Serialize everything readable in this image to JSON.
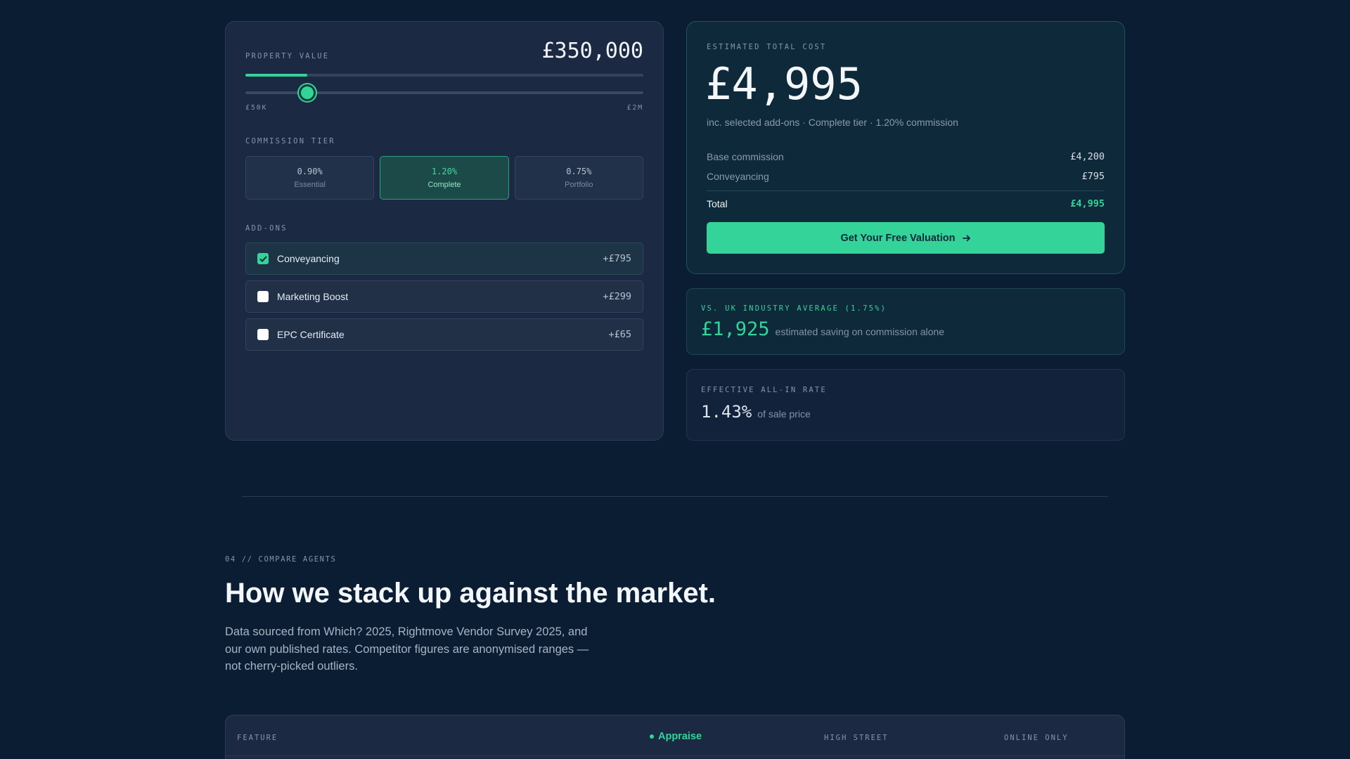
{
  "calculator": {
    "property_value_label": "PROPERTY VALUE",
    "property_value": "£350,000",
    "progress_fraction": 0.155,
    "slider_fraction": 0.155,
    "range_min": "£50K",
    "range_max": "£2M",
    "commission_tier_label": "COMMISSION TIER",
    "tiers": [
      {
        "pct": "0.90%",
        "name": "Essential",
        "selected": false
      },
      {
        "pct": "1.20%",
        "name": "Complete",
        "selected": true
      },
      {
        "pct": "0.75%",
        "name": "Portfolio",
        "selected": false
      }
    ],
    "addons_label": "ADD-ONS",
    "addons": [
      {
        "name": "Conveyancing",
        "price": "+£795",
        "checked": true
      },
      {
        "name": "Marketing Boost",
        "price": "+£299",
        "checked": false
      },
      {
        "name": "EPC Certificate",
        "price": "+£65",
        "checked": false
      }
    ]
  },
  "summary": {
    "label": "ESTIMATED TOTAL COST",
    "total": "£4,995",
    "subtitle": "inc. selected add-ons · Complete tier · 1.20% commission",
    "rows": [
      {
        "label": "Base commission",
        "value": "£4,200"
      },
      {
        "label": "Conveyancing",
        "value": "£795"
      }
    ],
    "total_row": {
      "label": "Total",
      "value": "£4,995"
    },
    "cta_label": "Get Your Free Valuation"
  },
  "saving": {
    "label": "VS. UK INDUSTRY AVERAGE (1.75%)",
    "amount": "£1,925",
    "text": "estimated saving on commission alone"
  },
  "rate": {
    "label": "EFFECTIVE ALL-IN RATE",
    "value": "1.43%",
    "text": "of sale price"
  },
  "compare": {
    "eyebrow": "04 // COMPARE AGENTS",
    "headline": "How we stack up against the market.",
    "description": "Data sourced from Which? 2025, Rightmove Vendor Survey 2025, and our own published rates. Competitor figures are anonymised ranges — not cherry-picked outliers.",
    "columns": {
      "feature": "FEATURE",
      "appraise": "Appraise",
      "high_street": "HIGH STREET",
      "online_only": "ONLINE ONLY"
    }
  },
  "colors": {
    "accent": "#34d399",
    "background": "#0b1d33",
    "card": "#1b2a42"
  }
}
